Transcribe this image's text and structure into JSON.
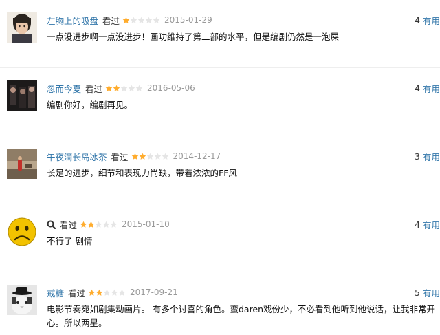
{
  "reviews": [
    {
      "user": "左胸上的吸盘",
      "status": "看过",
      "rating": 1,
      "date": "2015-01-29",
      "useful_count": "4",
      "useful_label": "有用",
      "text": "一点没进步啊一点没进步！画功维持了第二部的水平，但是编剧仍然是一泡屎",
      "avatar": "girl-portrait-avatar"
    },
    {
      "user": "忽而今夏",
      "status": "看过",
      "rating": 2,
      "date": "2016-05-06",
      "useful_count": "4",
      "useful_label": "有用",
      "text": "编剧你好，编剧再见。",
      "avatar": "dark-film-still-avatar"
    },
    {
      "user": "午夜滴长岛冰茶",
      "status": "看过",
      "rating": 2,
      "date": "2014-12-17",
      "useful_count": "3",
      "useful_label": "有用",
      "text": "长足的进步，细节和表现力尚缺，带着浓浓的FF风",
      "avatar": "red-figure-avatar"
    },
    {
      "user": "",
      "status": "看过",
      "rating": 2,
      "date": "2015-01-10",
      "useful_count": "4",
      "useful_label": "有用",
      "text": "不行了 剧情",
      "avatar": "sad-emoji-avatar"
    },
    {
      "user": "戒糖",
      "status": "看过",
      "rating": 2,
      "date": "2017-09-21",
      "useful_count": "5",
      "useful_label": "有用",
      "text": "电影节奏宛如剧集动画片。 有多个讨喜的角色。蛮daren戏份少，不必看到他听到他说话，让我非常开心。所以两星。",
      "avatar": "cat-with-hat-avatar"
    }
  ],
  "colors": {
    "link": "#3377aa",
    "star_on": "#ffac2d",
    "star_off": "#e5e5e5",
    "date": "#999999"
  }
}
